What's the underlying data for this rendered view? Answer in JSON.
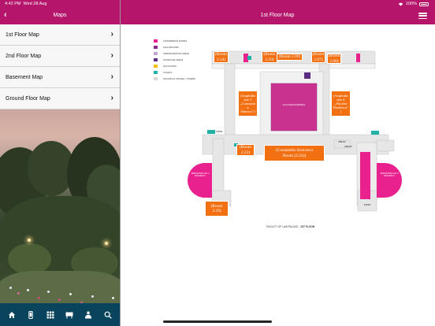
{
  "status": {
    "time": "4:42 PM",
    "date": "Wed 28 Aug",
    "battery": "100%"
  },
  "sidebar": {
    "title": "Maps",
    "items": [
      {
        "label": "1st Floor Map"
      },
      {
        "label": "2nd Floor Map"
      },
      {
        "label": "Basement Map"
      },
      {
        "label": "Ground Floor Map"
      }
    ]
  },
  "tabbar": {
    "icons": [
      "home-icon",
      "phone-icon",
      "grid-icon",
      "map-icon",
      "person-icon",
      "search-icon"
    ]
  },
  "main": {
    "title": "1st Floor Map"
  },
  "colors": {
    "brand": "#b5156b",
    "tabbar": "#08455c",
    "room_label": "#f26f12",
    "pink_area": "#e8218f"
  },
  "legend": [
    {
      "label": "Conference rooms",
      "color": "#e8218f"
    },
    {
      "label": "Halls/rooms",
      "color": "#8b2a86"
    },
    {
      "label": "Administration areas",
      "color": "#c3a6d4"
    },
    {
      "label": "Staircase areas",
      "color": "#5b2b86"
    },
    {
      "label": "Old rooms",
      "color": "#f2c200"
    },
    {
      "label": "Toilets",
      "color": "#1fb3a8"
    },
    {
      "label": "Technical spaces / others",
      "color": "#d8d8d8"
    }
  ],
  "rooms": [
    {
      "label": "(Room 2.14)"
    },
    {
      "label": "(Room 2.10)"
    },
    {
      "label": "(Room 2.09)"
    },
    {
      "label": "(Room 2.07)"
    },
    {
      "label": "(Room 2.06)"
    },
    {
      "label": "(Amphitheater 1 „Constantin Stătescu\")"
    },
    {
      "label": "(Amphitheater 6 „Nicolae Basilescu\")"
    },
    {
      "label": "(Room 2.22)"
    },
    {
      "label": "(Constantin Stoicescu Room (2.24))"
    },
    {
      "label": "(Room 2.20)"
    }
  ],
  "room_text": {
    "r214": "(Room\n2.14)",
    "r210": "(Room\n2.10)",
    "r209": "(Room 2.09)",
    "r207": "(Room\n2.07)",
    "r206": "(Room\n2.06)",
    "amf1": "(Amphithe\natre 1\n„Constanti\nn\nStătescu\")",
    "amf6": "(Amphithe\natre 6\n„Nicolae\nBasilescu\"\n)",
    "r222": "(Room\n2.22)",
    "r224": "(Constantin Stoicescu\nRoom (2.24))",
    "r220": "(Room\n2.20)"
  },
  "plan_labels": {
    "central": "Sala Paşilor Pierduţi",
    "left_round": "Amfiteatrul nr. 2 Basilescu",
    "right_round": "Amfiteatrul nr. 5 Basilescu",
    "library_left": "Library",
    "library_right": "Library",
    "stair_bottom": "Stairs",
    "stair_top_left": "Stairs"
  },
  "caption": {
    "prefix": "FACULTY OF LAW PALACE - ",
    "floor": "1ST FLOOR"
  }
}
